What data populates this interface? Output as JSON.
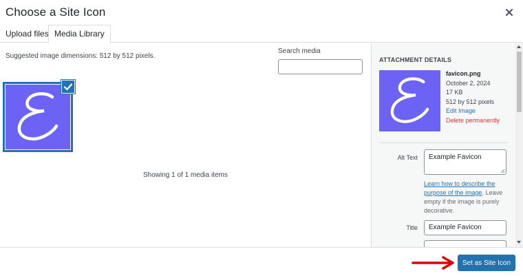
{
  "modal": {
    "title": "Choose a Site Icon",
    "close_icon": "close-icon"
  },
  "tabs": [
    {
      "label": "Upload files",
      "active": false
    },
    {
      "label": "Media Library",
      "active": true
    }
  ],
  "library": {
    "suggested": "Suggested image dimensions: 512 by 512 pixels.",
    "search_label": "Search media",
    "search_value": "",
    "showing": "Showing 1 of 1 media items",
    "selected_item": {
      "glyph": "E",
      "checked": true
    }
  },
  "details": {
    "heading": "Attachment Details",
    "filename": "favicon.png",
    "date": "October 2, 2024",
    "size": "17 KB",
    "dimensions": "512 by 512 pixels",
    "edit_link": "Edit Image",
    "delete_link": "Delete permanently",
    "alt_label": "Alt Text",
    "alt_value": "Example Favicon",
    "alt_help_link": "Learn how to describe the purpose of the image",
    "alt_help_rest": ". Leave empty if the image is purely decorative.",
    "title_label": "Title",
    "title_value": "Example Favicon"
  },
  "footer": {
    "primary_button": "Set as Site Icon"
  },
  "colors": {
    "accent": "#2271b1",
    "thumbnail_bg": "#6c63f5",
    "delete": "#d63638",
    "arrow": "#e00000"
  }
}
